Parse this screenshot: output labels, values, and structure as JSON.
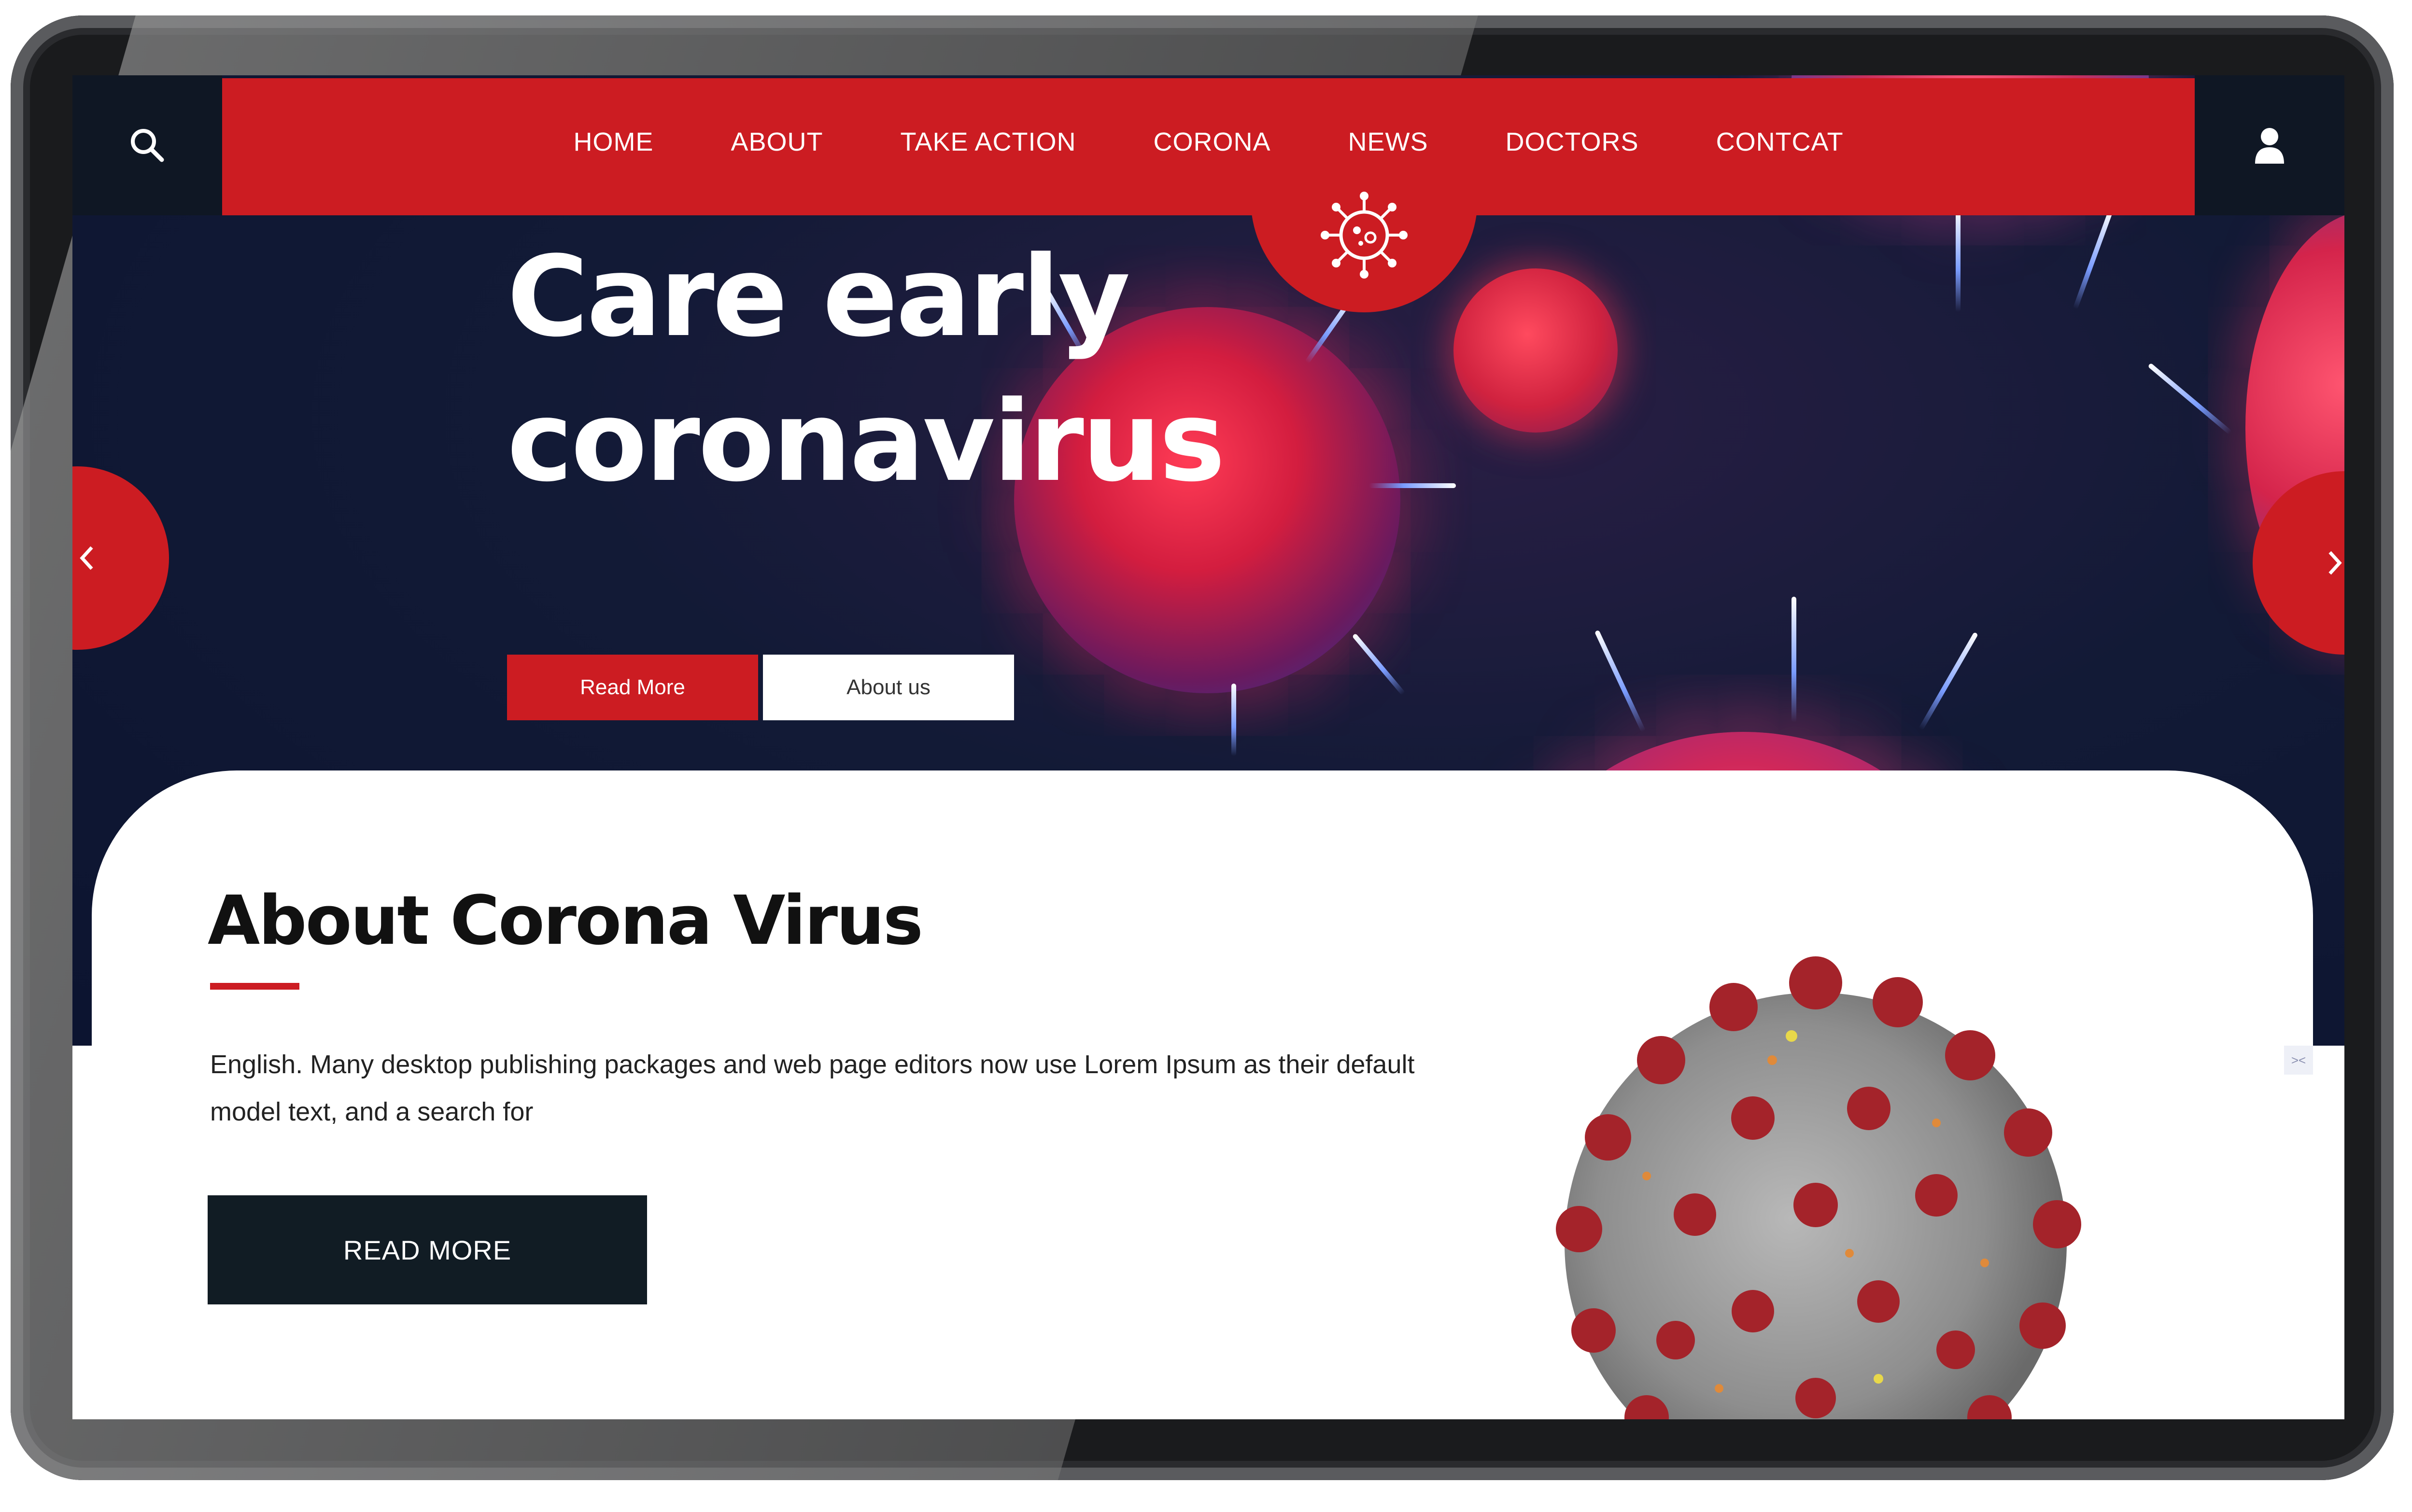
{
  "nav": {
    "items": [
      "HOME",
      "ABOUT",
      "TAKE ACTION",
      "CORONA",
      "NEWS",
      "DOCTORS",
      "CONTCAT"
    ]
  },
  "hero": {
    "title_line1": "Care early",
    "title_line2": "coronavirus",
    "read_more_label": "Read More",
    "about_label": "About us"
  },
  "about": {
    "title": "About Corona Virus",
    "text": "English. Many desktop publishing packages and web page editors now use Lorem Ipsum as their default model text, and a search for",
    "button_label": "READ MORE"
  },
  "icons": {
    "search": "search-icon",
    "user": "user-icon",
    "virus": "virus-icon",
    "prev": "chevron-left-icon",
    "next": "chevron-right-icon"
  },
  "colors": {
    "accent_red": "#cc1c22",
    "dark_navy": "#0f1724",
    "hero_bg": "#121a36"
  }
}
